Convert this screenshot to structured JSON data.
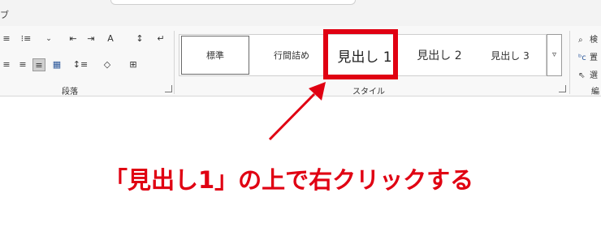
{
  "titlebar": {
    "tab_partial": "ブ"
  },
  "paragraph": {
    "label": "段落",
    "row1": [
      "≡",
      "⁝≡",
      "⇤",
      "⇥",
      "A",
      "↕",
      "↵"
    ],
    "row2": [
      "≡",
      "≡",
      "≡",
      "▦",
      "↕≡",
      "◇",
      "⊞"
    ]
  },
  "styles": {
    "label": "スタイル",
    "items": [
      "標準",
      "行間詰め",
      "見出し 1",
      "見出し 2",
      "見出し 3"
    ],
    "more": "▿"
  },
  "editing": {
    "items": [
      {
        "icon": "search-icon",
        "label": "検"
      },
      {
        "icon": "replace-icon",
        "label": "置"
      },
      {
        "icon": "select-icon",
        "label": "選"
      }
    ],
    "label": "編"
  },
  "annotation": {
    "text": "「見出し1」の上で右クリックする"
  },
  "colors": {
    "highlight": "#e00012",
    "annotation": "#e00012"
  }
}
